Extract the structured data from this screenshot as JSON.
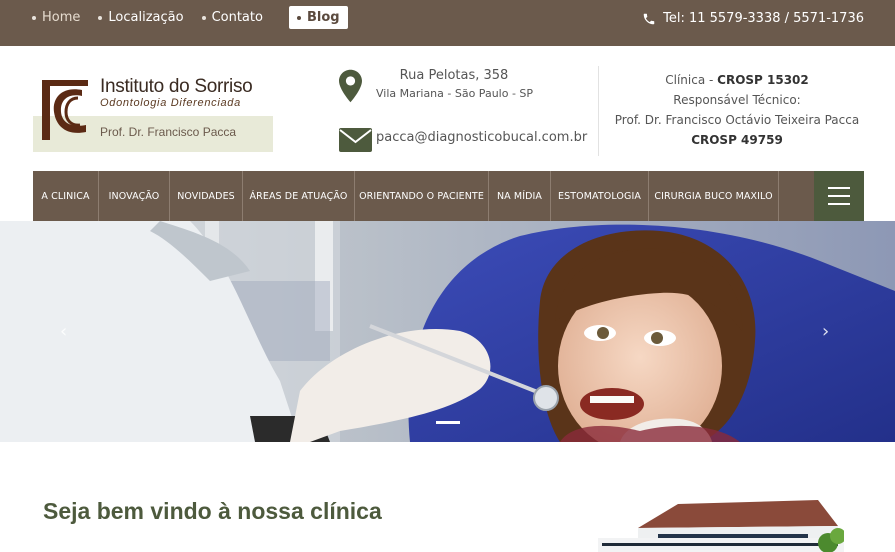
{
  "topnav": {
    "items": [
      "Home",
      "Localização",
      "Contato"
    ],
    "blog_label": "Blog"
  },
  "phone": {
    "text": "Tel: 11 5579-3338 / 5571-1736",
    "icon": "phone-icon"
  },
  "logo": {
    "title": "Instituto do Sorriso",
    "subtitle": "Odontologia Diferenciada",
    "doctor": "Prof. Dr. Francisco Pacca"
  },
  "address": {
    "line1": "Rua Pelotas, 358",
    "line2": "Vila Mariana - São Paulo - SP",
    "email": "pacca@diagnosticobucal.com.br"
  },
  "clinic_info": {
    "clinic_label": "Clínica - ",
    "clinic_crosp": "CROSP 15302",
    "responsible_label": "Responsável Técnico:",
    "responsible_name": "Prof. Dr. Francisco Octávio Teixeira Pacca",
    "responsible_crosp": "CROSP 49759"
  },
  "mainnav": {
    "items": [
      "A CLINICA",
      "INOVAÇÃO",
      "NOVIDADES",
      "ÁREAS DE ATUAÇÃO",
      "ORIENTANDO O PACIENTE",
      "NA MÍDIA",
      "ESTOMATOLOGIA",
      "CIRURGIA BUCO MAXILO"
    ]
  },
  "hero": {
    "prev": "‹",
    "next": "›"
  },
  "welcome": {
    "title": "Seja bem vindo à nossa clínica"
  },
  "colors": {
    "brown": "#6b5a4c",
    "olive": "#4d5a3d",
    "band": "#e8ead8"
  }
}
